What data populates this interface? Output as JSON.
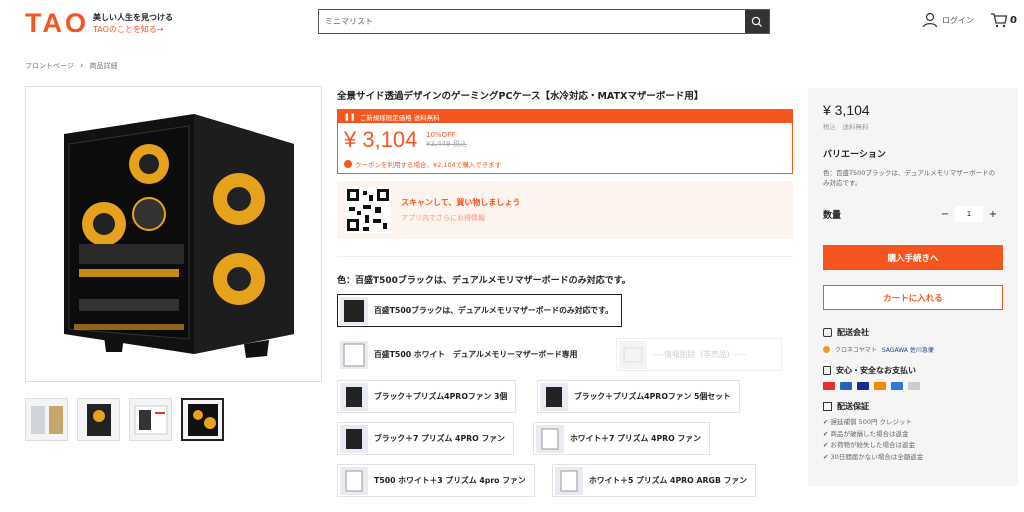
{
  "header": {
    "logo": "TAO",
    "tagline_1": "美しい人生を見つける",
    "tagline_2": "TAOのことを知る→",
    "search_value": "ミニマリスト",
    "login": "ログイン",
    "cart_count": "0"
  },
  "breadcrumb": [
    "フロントページ",
    "商品詳細"
  ],
  "product": {
    "title": "全景サイド透過デザインのゲーミングPCケース【水冷対応・MATXマザーボード用】",
    "promo_label": "ご新規様限定価格 送料無料",
    "price": "¥ 3,104",
    "discount": "10%OFF",
    "old_price": "¥3,449 税込",
    "coupon": "クーポンを利用する場合、¥2,104で購入できます",
    "qr_title": "スキャンして、買い物しましょう",
    "qr_sub": "アプリ内でさらにお得情報",
    "color_label": "色：百盛T500ブラックは、デュアルメモリマザーボードのみ対応です。",
    "options": [
      "百盛T500ブラックは、デュアルメモリマザーボードのみ対応です。",
      "百盛T500 ホワイト　デュアルメモリーマザーボード専用",
      "----情報削除（非売品）----",
      "ブラック＋プリズム4PROファン 3個",
      "ブラック＋プリズム4PROファン 5個セット",
      "ブラック＋7 プリズム 4PRO ファン",
      "ホワイト＋7 プリズム 4PRO ファン",
      "T500 ホワイト＋3 プリズム 4pro ファン",
      "ホワイト＋5 プリズム 4PRO ARGB ファン"
    ]
  },
  "side": {
    "price": "¥ 3,104",
    "tax": "税込　送料無料",
    "variation_title": "バリエーション",
    "variation_text": "色：百盛T500ブラックは、デュアルメモリマザーボードのみ対応です。",
    "qty_label": "数量",
    "qty_value": "1",
    "buy": "購入手続きへ",
    "cart": "カートに入れる",
    "shipping_title": "配送会社",
    "ship_1": "クロネコヤマト",
    "ship_2": "SAGAWA 佐川急便",
    "pay_title": "安心・安全なお支払い",
    "guarantee_title": "配送保証",
    "guarantees": [
      "✔ 遅延補償 500円 クレジット",
      "✔ 商品が破損した場合は返金",
      "✔ お荷物が紛失した場合は返金",
      "✔ 30日間届かない場合は全額返金"
    ]
  }
}
